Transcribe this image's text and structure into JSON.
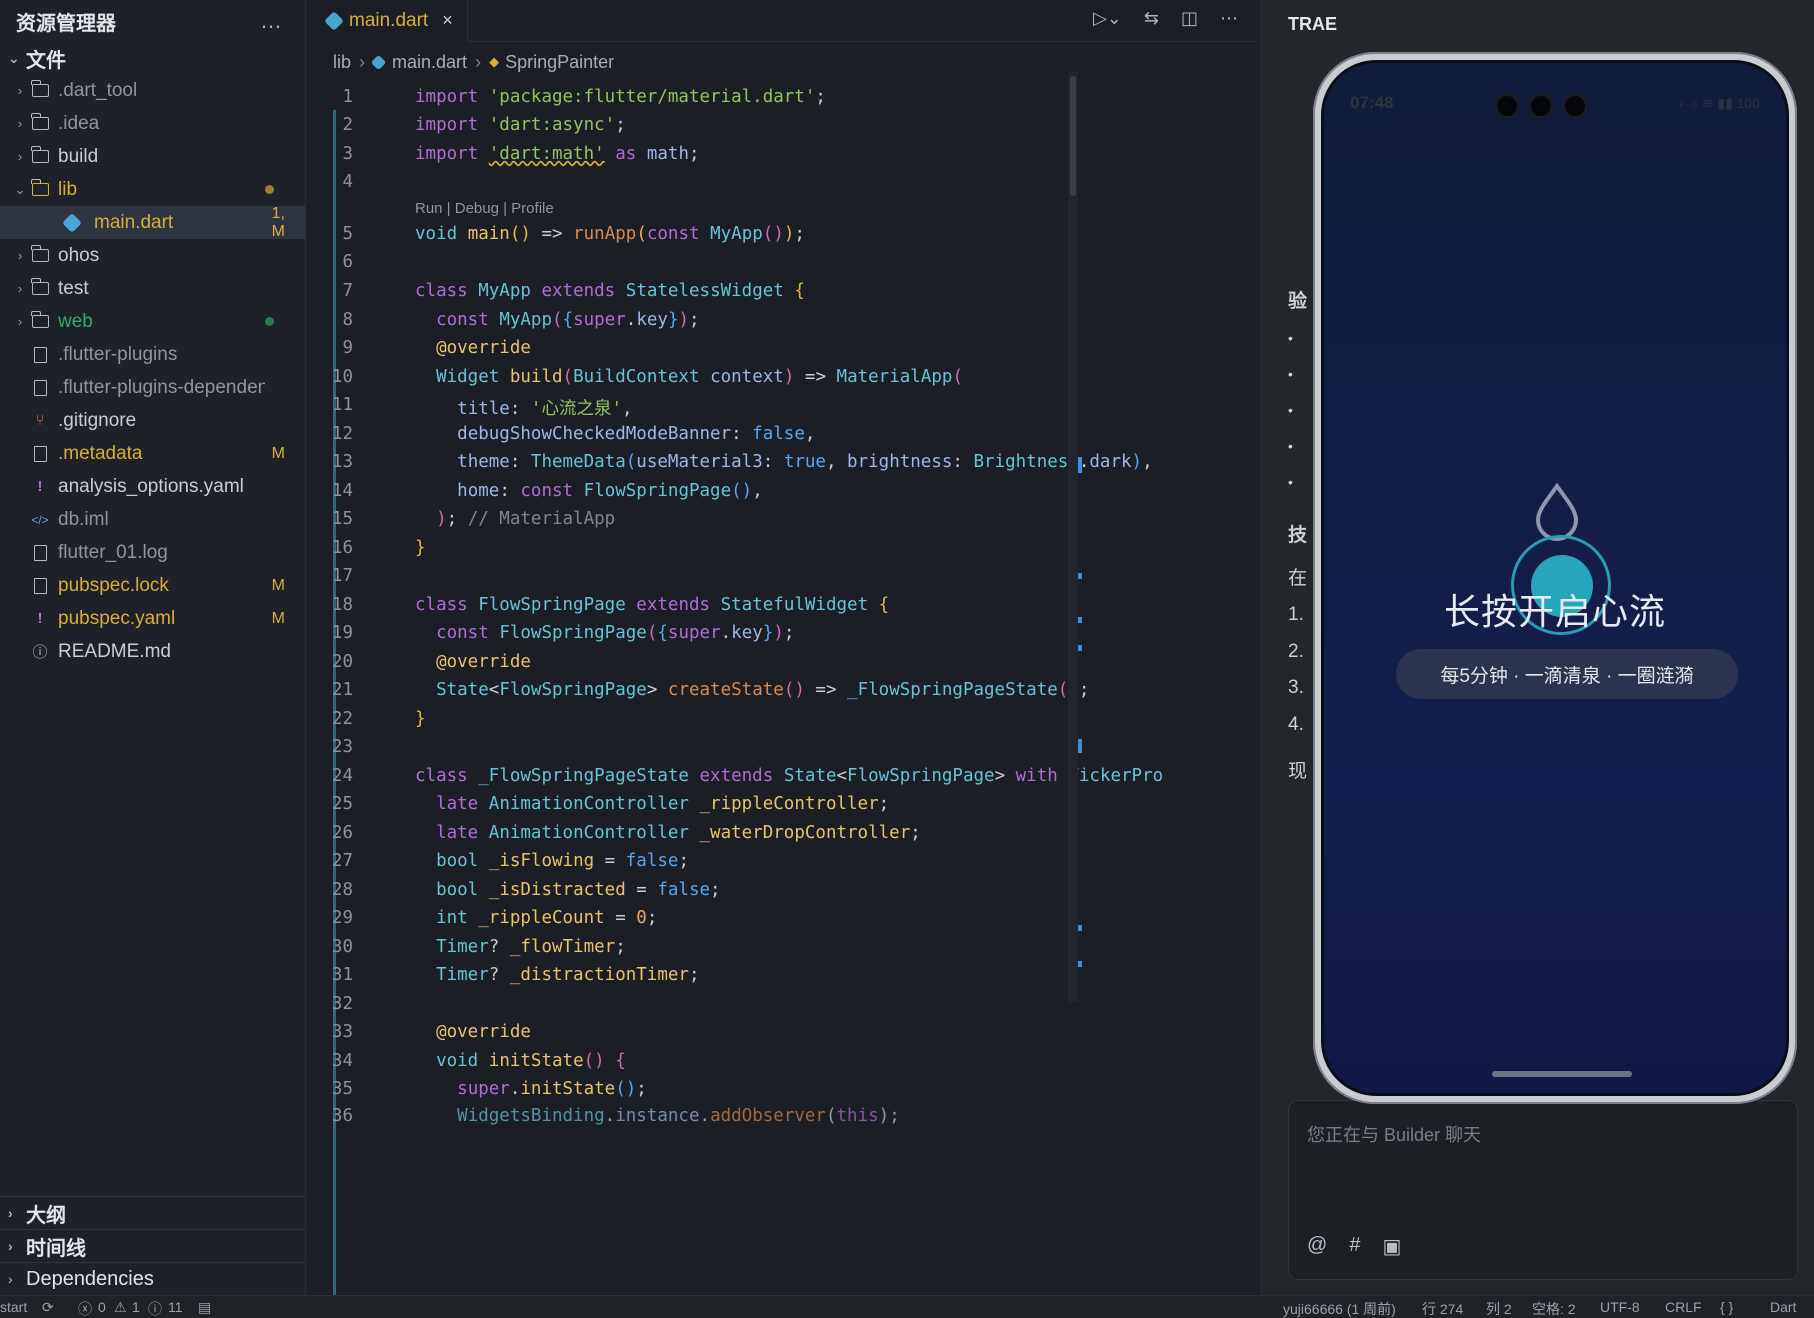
{
  "explorer": {
    "title": "资源管理器",
    "more_icon": "…",
    "root_label": "文件",
    "items": [
      {
        "name": ".dart_tool",
        "type": "folder",
        "expanded": false,
        "badge": ""
      },
      {
        "name": ".idea",
        "type": "folder",
        "expanded": false,
        "badge": ""
      },
      {
        "name": "build",
        "type": "folder",
        "expanded": false,
        "badge": ""
      },
      {
        "name": "lib",
        "type": "folder",
        "expanded": true,
        "badge": "",
        "status": "yellow-dot"
      },
      {
        "name": "main.dart",
        "type": "dart",
        "selected": true,
        "badge": "1, M"
      },
      {
        "name": "ohos",
        "type": "folder",
        "expanded": false,
        "badge": ""
      },
      {
        "name": "test",
        "type": "folder",
        "expanded": false,
        "badge": ""
      },
      {
        "name": "web",
        "type": "folder",
        "expanded": false,
        "badge": "",
        "status": "green-dot"
      },
      {
        "name": ".flutter-plugins",
        "type": "file",
        "badge": ""
      },
      {
        "name": ".flutter-plugins-dependen...",
        "type": "file",
        "badge": ""
      },
      {
        "name": ".gitignore",
        "type": "git",
        "badge": ""
      },
      {
        "name": ".metadata",
        "type": "file",
        "badge": "M"
      },
      {
        "name": "analysis_options.yaml",
        "type": "yaml",
        "badge": ""
      },
      {
        "name": "db.iml",
        "type": "code",
        "badge": ""
      },
      {
        "name": "flutter_01.log",
        "type": "file",
        "badge": ""
      },
      {
        "name": "pubspec.lock",
        "type": "file",
        "badge": "M"
      },
      {
        "name": "pubspec.yaml",
        "type": "yaml",
        "badge": "M"
      },
      {
        "name": "README.md",
        "type": "info",
        "badge": ""
      }
    ],
    "bottom_sections": [
      "大纲",
      "时间线",
      "Dependencies"
    ]
  },
  "editor": {
    "tab": {
      "label": "main.dart",
      "close": "×"
    },
    "breadcrumb": [
      "lib",
      "main.dart",
      "SpringPainter"
    ],
    "codelens": "Run | Debug | Profile",
    "line_numbers": [
      "1",
      "2",
      "3",
      "4",
      "5",
      "6",
      "7",
      "8",
      "9",
      "10",
      "11",
      "12",
      "13",
      "14",
      "15",
      "16",
      "17",
      "18",
      "19",
      "20",
      "21",
      "22",
      "23",
      "24",
      "25",
      "26",
      "27",
      "28",
      "29",
      "30",
      "31",
      "32",
      "33",
      "34",
      "35",
      "36"
    ]
  },
  "panel": {
    "title": "TRAE",
    "fragments": [
      "验",
      "•",
      "•",
      "•",
      "•",
      "•",
      "技",
      "在",
      "1.",
      "2.",
      "3.",
      "4.",
      "现"
    ],
    "chat_placeholder": "您正在与 Builder 聊天",
    "chat_icons": [
      "@",
      "#",
      "▣"
    ]
  },
  "phone": {
    "time": "07:48",
    "status_icons": "‹··› ≋ ▮▮ 100",
    "hero_text": "长按开启心流",
    "pill_text": "每5分钟 · 一滴清泉 · 一圈涟漪",
    "colors": {
      "accent": "#27a6bb",
      "bg_top": "#111b3b",
      "bg_bottom": "#151e4e"
    }
  },
  "statusbar": {
    "left": "start",
    "errors": "0",
    "warnings": "1",
    "infos": "11",
    "user": "yuji66666 (1 周前)",
    "line": "行 274",
    "col": "列 2",
    "indent": "空格: 2",
    "encoding": "UTF-8",
    "eol": "CRLF",
    "braces": "{ }",
    "lang": "Dart"
  }
}
